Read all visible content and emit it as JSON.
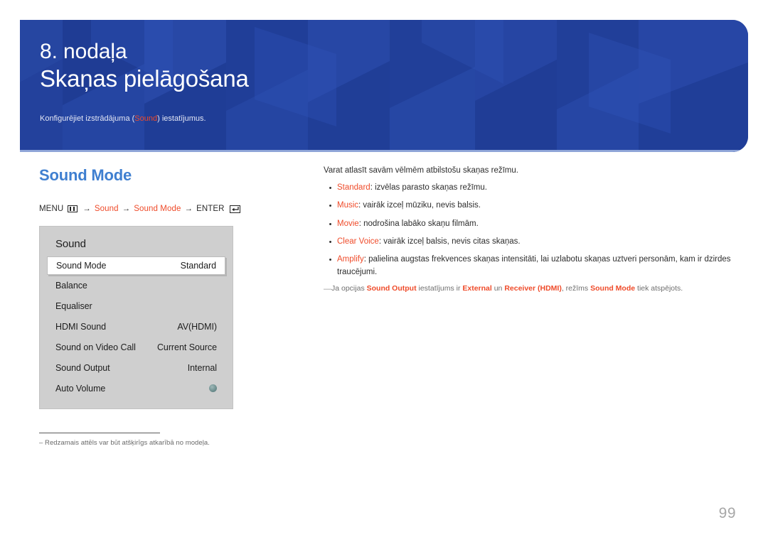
{
  "header": {
    "chapter_number": "8. nodaļa",
    "chapter_title": "Skaņas pielāgošana",
    "subtitle_before": "Konfigurējiet izstrādājuma (",
    "subtitle_highlight": "Sound",
    "subtitle_after": ") iestatījumus.",
    "background_color": "#22409a",
    "underline_color": "#8fa5d8"
  },
  "section": {
    "title": "Sound Mode",
    "title_color": "#3f7fd0",
    "menu_path": {
      "menu_label": "MENU",
      "menu_icon": "menu-grid-icon",
      "arrow1": "→",
      "step1": "Sound",
      "arrow2": "→",
      "step2": "Sound Mode",
      "arrow3": "→",
      "enter_label": "ENTER",
      "enter_icon": "enter-return-icon",
      "accent_color": "#ef4b2a"
    }
  },
  "osd": {
    "title": "Sound",
    "rows": [
      {
        "label": "Sound Mode",
        "value": "Standard",
        "selected": true,
        "type": "value"
      },
      {
        "label": "Balance",
        "value": "",
        "selected": false,
        "type": "value"
      },
      {
        "label": "Equaliser",
        "value": "",
        "selected": false,
        "type": "value"
      },
      {
        "label": "HDMI Sound",
        "value": "AV(HDMI)",
        "selected": false,
        "type": "value"
      },
      {
        "label": "Sound on Video Call",
        "value": "Current Source",
        "selected": false,
        "type": "value"
      },
      {
        "label": "Sound Output",
        "value": "Internal",
        "selected": false,
        "type": "value"
      },
      {
        "label": "Auto Volume",
        "value": "",
        "selected": false,
        "type": "toggle"
      }
    ],
    "note": "Redzamais attēls var būt atšķirīgs atkarībā no modeļa.",
    "note_dash": "‒",
    "panel_color": "#cfcfcf"
  },
  "description": {
    "intro": "Varat atlasīt savām vēlmēm atbilstošu skaņas režīmu.",
    "bullet_marker": "•",
    "bullets": [
      {
        "term": "Standard",
        "text": ": izvēlas parasto skaņas režīmu."
      },
      {
        "term": "Music",
        "text": ": vairāk izceļ mūziku, nevis balsis."
      },
      {
        "term": "Movie",
        "text": ": nodrošina labāko skaņu filmām."
      },
      {
        "term": "Clear Voice",
        "text": ": vairāk izceļ balsis, nevis citas skaņas."
      },
      {
        "term": "Amplify",
        "text": ": palielina augstas frekvences skaņas intensitāti, lai uzlabotu skaņas uztveri personām, kam ir dzirdes traucējumi."
      }
    ],
    "footnote": {
      "dash": "―",
      "p1": "Ja opcijas ",
      "t1": "Sound Output",
      "p2": " iestatījums ir ",
      "t2": "External",
      "p3": " un ",
      "t3": "Receiver (HDMI)",
      "p4": ", režīms ",
      "t4": "Sound Mode",
      "p5": " tiek atspējots."
    }
  },
  "page_number": "99"
}
